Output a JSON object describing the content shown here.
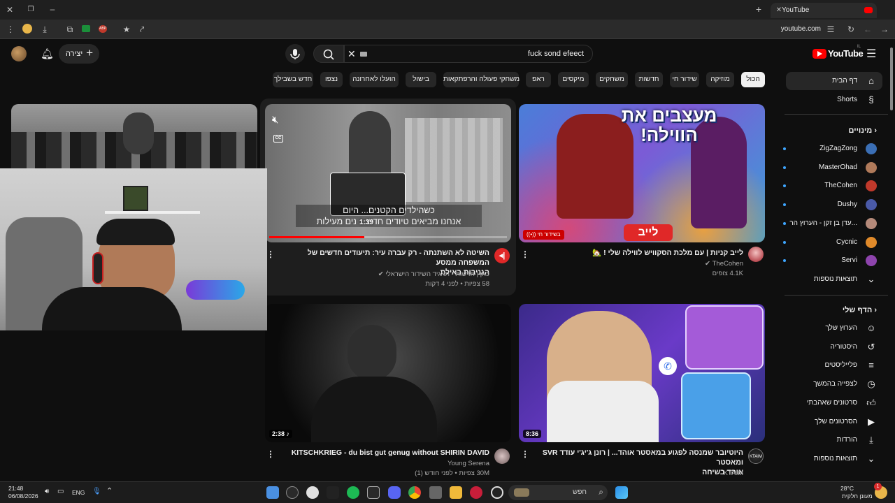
{
  "browser": {
    "tab_title": "YouTube",
    "url": "youtube.com"
  },
  "header": {
    "logo_text": "YouTube",
    "logo_region": "IL",
    "search_value": "fuck sond efeect",
    "create_label": "יצירה"
  },
  "chips": [
    "הכול",
    "מוזיקה",
    "שידור חי",
    "חדשות",
    "משחקים",
    "מיקסים",
    "ראפ",
    "משחקי פעולה והרפתקאות",
    "בישול",
    "הועלו לאחרונה",
    "נצפו",
    "חדש בשבילך"
  ],
  "sidebar": {
    "home_label": "דף הבית",
    "shorts_label": "Shorts",
    "subs_heading": "מינויים",
    "subs": [
      {
        "name": "ZigZagZong",
        "color": "#3b6fb5"
      },
      {
        "name": "MasterOhad",
        "color": "#b07a5a"
      },
      {
        "name": "TheCohen",
        "color": "#c0392b"
      },
      {
        "name": "Dushy",
        "color": "#4a5aa8"
      },
      {
        "name": "עדן בן זקן - הערוץ הר...",
        "color": "#b58a7a"
      },
      {
        "name": "Cycnic",
        "color": "#e08a2a"
      },
      {
        "name": "Servi",
        "color": "#8e44ad"
      }
    ],
    "subs_more": "תוצאות נוספות",
    "you_heading": "הדף שלי",
    "you_items": [
      {
        "label": "הערוץ שלך",
        "icon": "channel-icon"
      },
      {
        "label": "היסטוריה",
        "icon": "history-icon"
      },
      {
        "label": "פלייליסטים",
        "icon": "playlists-icon"
      },
      {
        "label": "לצפייה בהמשך",
        "icon": "watch-later-icon"
      },
      {
        "label": "סרטונים שאהבתי",
        "icon": "liked-icon"
      },
      {
        "label": "הסרטונים שלך",
        "icon": "your-videos-icon"
      },
      {
        "label": "הורדות",
        "icon": "downloads-icon"
      }
    ],
    "you_more": "תוצאות נוספות"
  },
  "videos": {
    "v1": {
      "title": "לייב קניות | עם מלכת הסקוויש לווילה שלי ! 🏡",
      "channel": "TheCohen",
      "views": "4.1K צופים",
      "badge": "בשידור חי",
      "thumb_headline": "מעצבים את הווילה!",
      "thumb_live": "לייב"
    },
    "v2": {
      "title_line1": "השיטה לא השתנתה - רק עברה עיר: תיעודים חדשים של המשפחה ממסע",
      "title_line2": "הגניבות באילת",
      "channel": "כאן | חדשות - תאגיד השידור הישראלי",
      "meta": "58 צפיות • לפני 4 דקות",
      "preview_time": "1:39",
      "caption1": "כשהילדים הקטנים... היום",
      "caption2": "אנחנו מביאים טיודים חדש... נים מעילות",
      "progress": 0.4
    },
    "v3": {
      "title_line1": "היוטיובר שמנסה לפגוע במאסטר אוהד... | רונן ג'יג'י עודד SVR ומאסטר",
      "title_line2": "אוהד בשיחה",
      "channel": "KTAIM",
      "duration": "8:36"
    },
    "v4": {
      "title": "KITSCHKRIEG - du bist gut genug without SHIRIN DAVID",
      "channel": "Young Serena",
      "meta": "30M צפיות • לפני חודש (1)",
      "duration": "2:38"
    }
  },
  "taskbar": {
    "time": "21:48",
    "date": "06/08/2026",
    "lang": "ENG",
    "search_placeholder": "חפש",
    "weather_temp": "28°C",
    "weather_desc": "מעונן חלקית",
    "notif_count": "1"
  }
}
